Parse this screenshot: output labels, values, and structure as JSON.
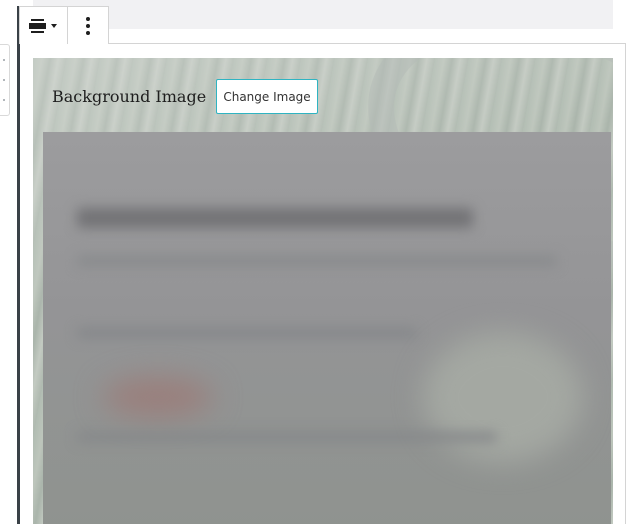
{
  "block": {
    "toolbar": {
      "align_icon": "align-wide-icon",
      "align_dropdown_icon": "caret-down-icon",
      "more_icon": "vertical-ellipsis-icon"
    },
    "mover_icon": "drag-handle-icon"
  },
  "cover": {
    "label": "Background Image",
    "change_button": "Change Image"
  },
  "colors": {
    "accent_border": "#2fb4c2",
    "selection_bar": "#3a4147",
    "frame_border": "#d4d4d4"
  }
}
